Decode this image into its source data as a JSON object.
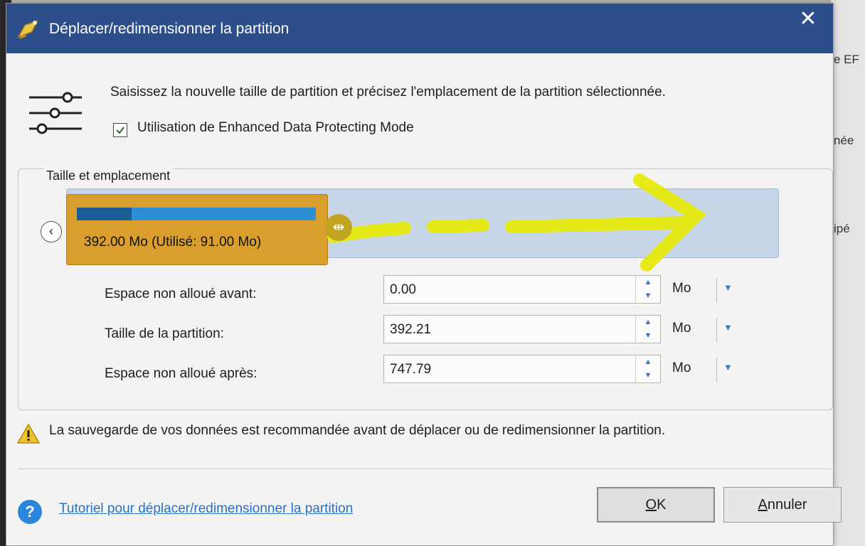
{
  "background": {
    "fragments": [
      "e EF",
      "née",
      "ipé"
    ]
  },
  "dialog": {
    "title": "Déplacer/redimensionner la partition",
    "close_icon": "close-icon",
    "instruction": "Saisissez la nouvelle taille de partition et précisez l'emplacement de la partition sélectionnée.",
    "enhanced_mode": {
      "label": "Utilisation de Enhanced Data Protecting Mode",
      "checked": true
    },
    "group_title": "Taille et emplacement",
    "partition": {
      "label": "392.00 Mo (Utilisé: 91.00 Mo)",
      "used_fraction": 0.23
    },
    "fields": [
      {
        "label": "Espace non alloué avant:",
        "value": "0.00",
        "unit": "Mo"
      },
      {
        "label": "Taille de la partition:",
        "value": "392.21",
        "unit": "Mo"
      },
      {
        "label": "Espace non alloué après:",
        "value": "747.79",
        "unit": "Mo"
      }
    ],
    "warning": "La sauvegarde de vos données est recommandée avant de déplacer ou de redimensionner la partition.",
    "help_link": "Tutoriel pour déplacer/redimensionner la partition",
    "ok_button": {
      "mnemonic": "O",
      "rest": "K"
    },
    "cancel_button": {
      "mnemonic": "A",
      "rest": "nnuler"
    }
  },
  "colors": {
    "titlebar": "#2c4f8c",
    "partition": "#d99e2c",
    "used": "#1d5d96",
    "free_bar": "#2f8fd6",
    "link": "#2a72c8",
    "highlight_arrow": "#e6ea00"
  }
}
